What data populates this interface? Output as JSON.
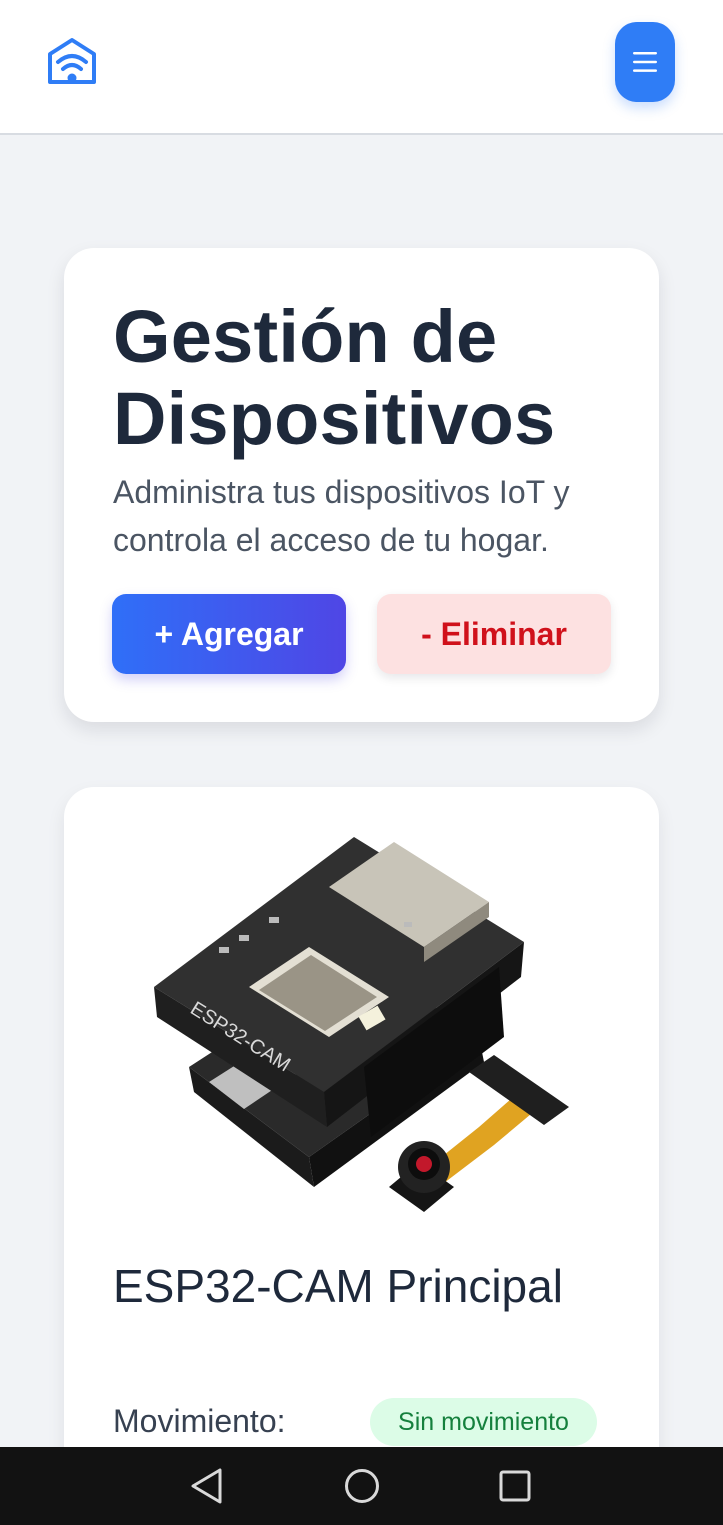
{
  "header": {
    "logo_icon": "home-wifi-icon",
    "menu_icon": "hamburger-menu-icon"
  },
  "hero": {
    "title": "Gestión de Dispositivos",
    "subtitle": "Administra tus dispositivos IoT y controla el acceso de tu hogar.",
    "add_label": "+ Agregar",
    "remove_label": "- Eliminar"
  },
  "device": {
    "image_icon": "esp32-cam-board-image",
    "name": "ESP32-CAM Principal",
    "motion_label": "Movimiento:",
    "motion_status": "Sin movimiento"
  },
  "navbar": {
    "back_icon": "back-triangle-icon",
    "home_icon": "home-circle-icon",
    "recents_icon": "recents-square-icon"
  },
  "colors": {
    "accent": "#2f7df6",
    "gradient_end": "#4f46e5",
    "danger_text": "#d0111b",
    "danger_bg": "#fde1e1",
    "success_text": "#15803d",
    "success_bg": "#dcfce7"
  }
}
